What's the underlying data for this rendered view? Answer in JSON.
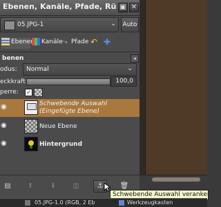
{
  "window": {
    "title": "Ebenen, Kanäle, Pfade, Rü",
    "menu_glyph": "▣",
    "close_glyph": "✕"
  },
  "image_selector": {
    "value": "05.JPG-1",
    "auto_label": "Auto"
  },
  "tabs": [
    {
      "label": "Ebenen",
      "icon": "layers-icon"
    },
    {
      "label": "Kanäle",
      "icon": "channels-icon"
    },
    {
      "label": "Pfade",
      "icon": "paths-icon"
    },
    {
      "label": "",
      "icon": "undo-icon"
    },
    {
      "label": "",
      "icon": "navigate-icon"
    }
  ],
  "layers_panel": {
    "title": "benen",
    "mode_label": "odus:",
    "mode_value": "Normal",
    "opacity_label": "eckkraft:",
    "opacity_value": "100,0",
    "opacity_fraction": 1.0,
    "lock_label": "perre:"
  },
  "layers": [
    {
      "name_line1": "Schwebende Auswahl",
      "name_line2": "(Eingefügte Ebene)",
      "selected": true,
      "visible": true,
      "thumb": "white"
    },
    {
      "name_line1": "Neue Ebene",
      "name_line2": "",
      "selected": false,
      "visible": true,
      "thumb": "checker"
    },
    {
      "name_line1": "Hintergrund",
      "name_line2": "",
      "selected": false,
      "visible": true,
      "thumb": "flower"
    }
  ],
  "tooltip": {
    "text": "Schwebende Auswahl verankern"
  },
  "taskbar": {
    "item1": "05.JPG-1.0 (RGB, 2 Eb",
    "item2": "Werkzeugkasten"
  },
  "colors": {
    "selected_row": "#a9783d",
    "canvas": "#4f3a27",
    "panel": "#4b4b4b"
  }
}
